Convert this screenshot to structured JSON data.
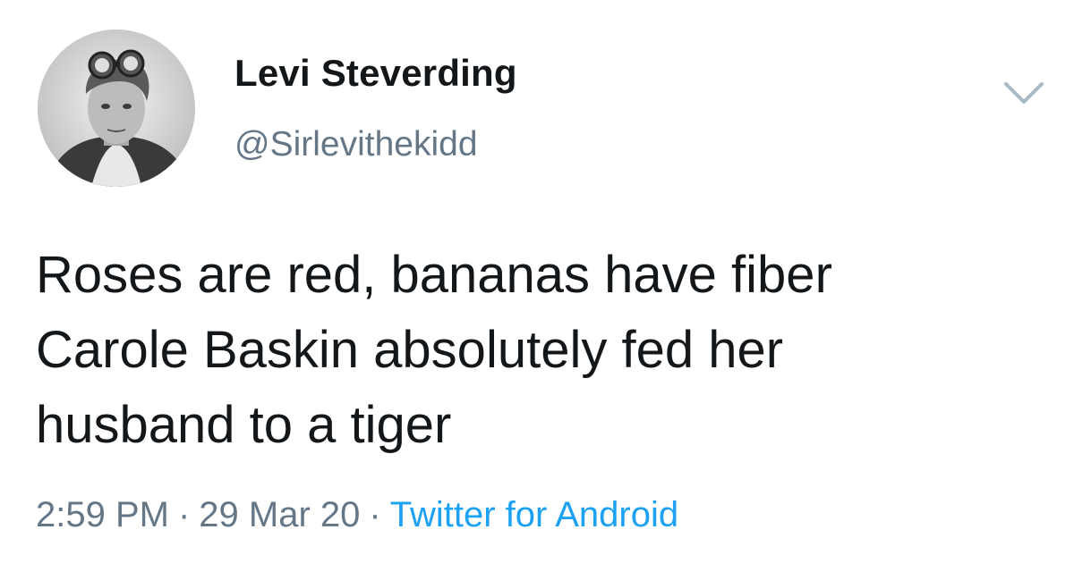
{
  "author": {
    "display_name": "Levi Steverding",
    "handle": "@Sirlevithekidd",
    "avatar_icon": "user-avatar-photo"
  },
  "menu": {
    "icon": "chevron-down-icon",
    "color": "#aab8c2"
  },
  "tweet": {
    "lines": [
      "Roses are red, bananas have fiber",
      "Carole Baskin absolutely fed her",
      "husband to a tiger"
    ]
  },
  "meta": {
    "time": "2:59 PM",
    "separator": "·",
    "date": "29 Mar 20",
    "source": "Twitter for Android"
  },
  "colors": {
    "text": "#14171a",
    "secondary": "#657786",
    "link": "#1da1f2"
  }
}
